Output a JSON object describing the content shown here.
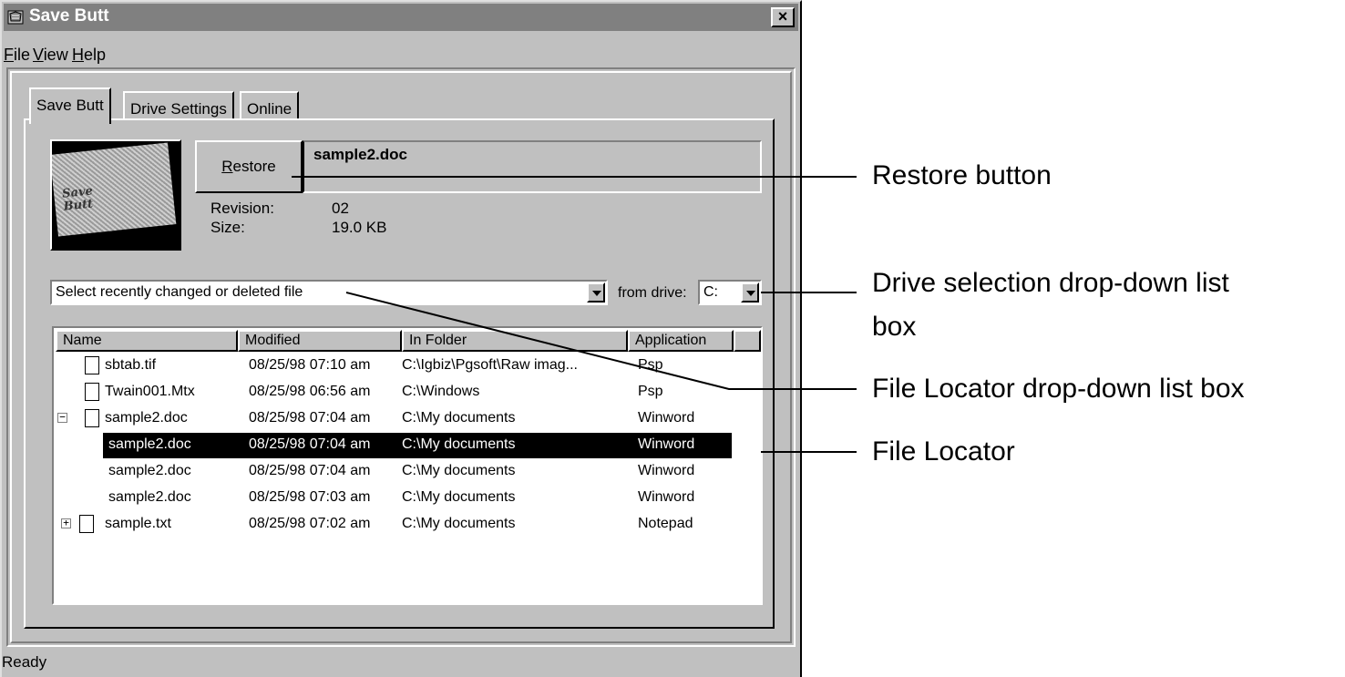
{
  "window": {
    "title": "Save Butt",
    "close_label": "×",
    "status": "Ready"
  },
  "menu": [
    {
      "accel": "F",
      "rest": "ile"
    },
    {
      "accel": "V",
      "rest": "iew"
    },
    {
      "accel": "H",
      "rest": "elp"
    }
  ],
  "tabs": [
    "Save Butt",
    "Drive Settings",
    "Online"
  ],
  "logo": {
    "line1": "Save",
    "line2": "Butt"
  },
  "restore": {
    "accel": "R",
    "rest": "estore"
  },
  "file": {
    "name": "sample2.doc",
    "revision_label": "Revision:",
    "revision_value": "02",
    "size_label": "Size:",
    "size_value": "19.0 KB"
  },
  "file_locator_combo": {
    "value": "Select recently changed or deleted file"
  },
  "drive": {
    "label": "from drive:",
    "value": "C:"
  },
  "list": {
    "columns": [
      "Name",
      "Modified",
      "In Folder",
      "Application"
    ],
    "rows": [
      {
        "name": "sbtab.tif",
        "modified": "08/25/98 07:10 am",
        "folder": "C:\\Igbiz\\Pgsoft\\Raw imag...",
        "app": "Psp"
      },
      {
        "name": "Twain001.Mtx",
        "modified": "08/25/98 06:56 am",
        "folder": "C:\\Windows",
        "app": "Psp"
      },
      {
        "name": "sample2.doc",
        "modified": "08/25/98 07:04 am",
        "folder": "C:\\My documents",
        "app": "Winword"
      },
      {
        "name": "sample2.doc",
        "modified": "08/25/98 07:04 am",
        "folder": "C:\\My documents",
        "app": "Winword"
      },
      {
        "name": "sample2.doc",
        "modified": "08/25/98 07:04 am",
        "folder": "C:\\My documents",
        "app": "Winword"
      },
      {
        "name": "sample2.doc",
        "modified": "08/25/98 07:03 am",
        "folder": "C:\\My documents",
        "app": "Winword"
      },
      {
        "name": "sample.txt",
        "modified": "08/25/98 07:02 am",
        "folder": "C:\\My documents",
        "app": "Notepad"
      }
    ],
    "tree_expanded": "−",
    "tree_collapsed": "+"
  },
  "callouts": {
    "restore_button": "Restore button",
    "drive_selection_line1": "Drive selection drop-down list",
    "drive_selection_line2": "box",
    "file_locator_dropdown": "File Locator drop-down list box",
    "file_locator": "File Locator"
  }
}
